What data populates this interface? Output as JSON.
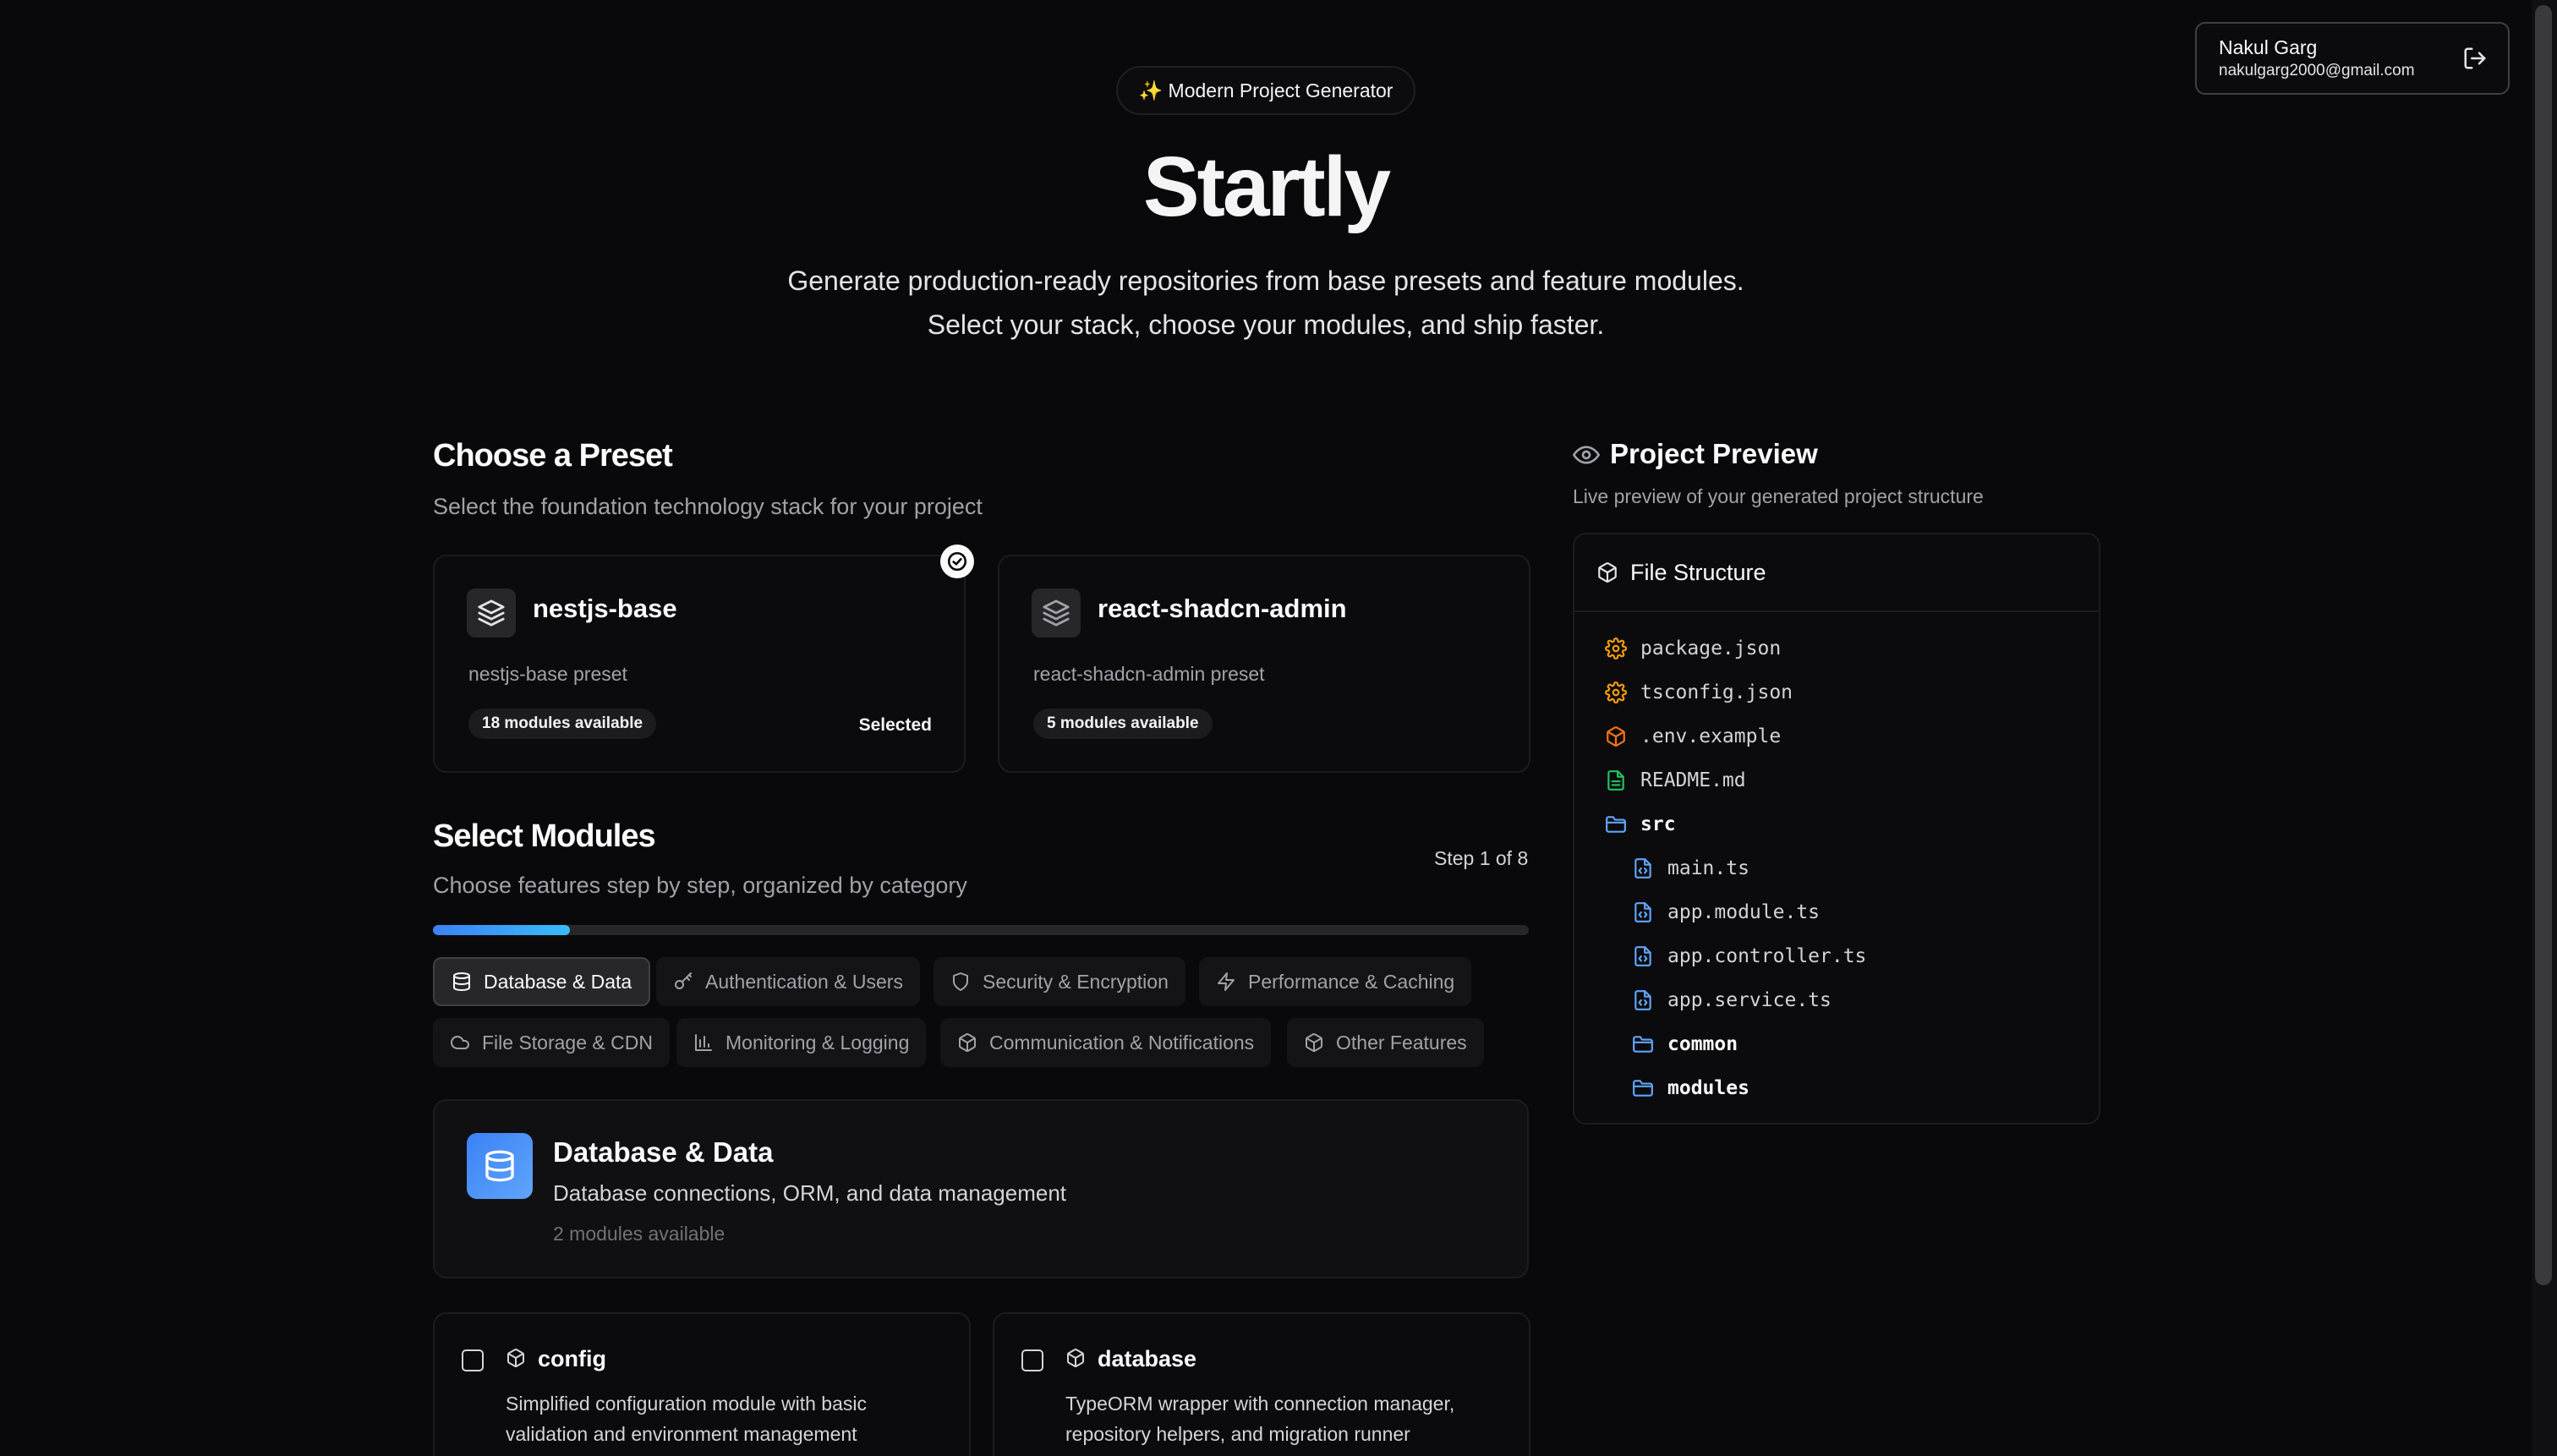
{
  "user": {
    "name": "Nakul Garg",
    "email": "nakulgarg2000@gmail.com"
  },
  "hero": {
    "badge": "✨ Modern Project Generator",
    "title": "Startly",
    "subtitle_line1": "Generate production-ready repositories from base presets and feature modules.",
    "subtitle_line2": "Select your stack, choose your modules, and ship faster."
  },
  "presets_section": {
    "title": "Choose a Preset",
    "description": "Select the foundation technology stack for your project",
    "presets": [
      {
        "name": "nestjs-base",
        "description": "nestjs-base preset",
        "modules": "18 modules available",
        "status": "Selected",
        "selected": true
      },
      {
        "name": "react-shadcn-admin",
        "description": "react-shadcn-admin preset",
        "modules": "5 modules available",
        "status": "",
        "selected": false
      }
    ]
  },
  "modules_section": {
    "title": "Select Modules",
    "description": "Choose features step by step, organized by category",
    "step_label": "Step 1 of 8",
    "progress_fraction": 0.125,
    "progress_color_start": "#3b82f6",
    "progress_color_end": "#38bdf8",
    "tabs": [
      {
        "label": "Database & Data",
        "icon": "database-icon",
        "active": true
      },
      {
        "label": "Authentication & Users",
        "icon": "key-icon",
        "active": false
      },
      {
        "label": "Security & Encryption",
        "icon": "shield-icon",
        "active": false
      },
      {
        "label": "Performance & Caching",
        "icon": "zap-icon",
        "active": false
      },
      {
        "label": "File Storage & CDN",
        "icon": "cloud-icon",
        "active": false
      },
      {
        "label": "Monitoring & Logging",
        "icon": "bar-chart-icon",
        "active": false
      },
      {
        "label": "Communication & Notifications",
        "icon": "package-icon",
        "active": false
      },
      {
        "label": "Other Features",
        "icon": "package-icon",
        "active": false
      }
    ],
    "category": {
      "title": "Database & Data",
      "description": "Database connections, ORM, and data management",
      "count": "2 modules available",
      "accent": "#3b82f6"
    },
    "modules": [
      {
        "name": "config",
        "description": "Simplified configuration module with basic validation and environment management"
      },
      {
        "name": "database",
        "description": "TypeORM wrapper with connection manager, repository helpers, and migration runner"
      }
    ]
  },
  "preview": {
    "title": "Project Preview",
    "description": "Live preview of your generated project structure",
    "tree_title": "File Structure",
    "files": [
      {
        "name": "package.json",
        "icon": "gear-icon",
        "kind": "config"
      },
      {
        "name": "tsconfig.json",
        "icon": "gear-icon",
        "kind": "config"
      },
      {
        "name": ".env.example",
        "icon": "package-icon",
        "kind": "env"
      },
      {
        "name": "README.md",
        "icon": "file-text-icon",
        "kind": "doc"
      },
      {
        "name": "src",
        "icon": "folder-icon",
        "kind": "dir"
      },
      {
        "name": "main.ts",
        "icon": "file-code-icon",
        "kind": "code"
      },
      {
        "name": "app.module.ts",
        "icon": "file-code-icon",
        "kind": "code"
      },
      {
        "name": "app.controller.ts",
        "icon": "file-code-icon",
        "kind": "code"
      },
      {
        "name": "app.service.ts",
        "icon": "file-code-icon",
        "kind": "code"
      },
      {
        "name": "common",
        "icon": "folder-icon",
        "kind": "dir"
      },
      {
        "name": "modules",
        "icon": "folder-icon",
        "kind": "dir"
      }
    ]
  }
}
